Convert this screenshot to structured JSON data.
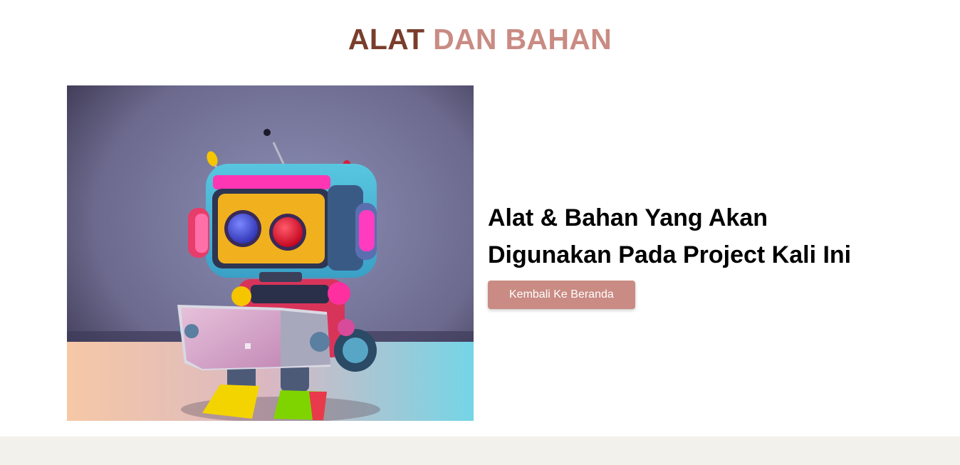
{
  "section": {
    "title_part1": "ALAT",
    "title_part2": "DAN BAHAN"
  },
  "hero": {
    "image_alt": "Colorful robot holding a tablet",
    "heading_line1": "Alat & Bahan Yang Akan",
    "heading_line2": "Digunakan Pada Project Kali Ini",
    "button_label": "Kembali Ke Beranda"
  },
  "colors": {
    "title_dark": "#7a3d2c",
    "title_accent": "#c98b83",
    "button_bg": "#c98b83",
    "footer_bg": "#f2f1ec"
  }
}
